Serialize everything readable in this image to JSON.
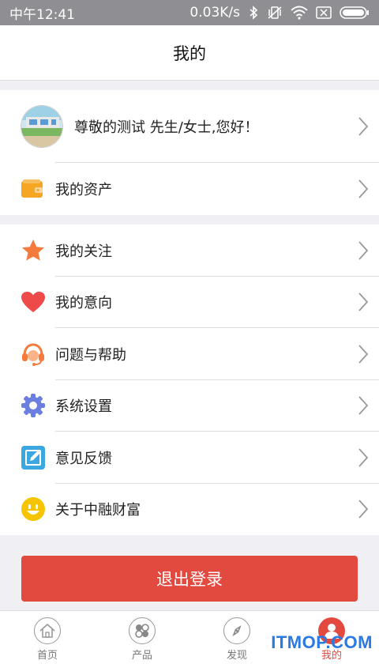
{
  "status_bar": {
    "time": "中午12:41",
    "speed": "0.03K/s"
  },
  "header": {
    "title": "我的"
  },
  "profile": {
    "greeting": "尊敬的测试 先生/女士,您好！"
  },
  "asset": {
    "label": "我的资产"
  },
  "menu": [
    {
      "label": "我的关注",
      "icon": "star-icon",
      "color": "#f47b3c"
    },
    {
      "label": "我的意向",
      "icon": "heart-icon",
      "color": "#ef4a4a"
    },
    {
      "label": "问题与帮助",
      "icon": "headset-icon",
      "color": "#f47b3c"
    },
    {
      "label": "系统设置",
      "icon": "gear-icon",
      "color": "#6a7fe0"
    },
    {
      "label": "意见反馈",
      "icon": "edit-icon",
      "color": "#3aa7e0"
    },
    {
      "label": "关于中融财富",
      "icon": "smiley-icon",
      "color": "#f6c400"
    }
  ],
  "logout": {
    "label": "退出登录"
  },
  "tabbar": {
    "tabs": [
      {
        "label": "首页",
        "icon": "home-icon"
      },
      {
        "label": "产品",
        "icon": "product-icon"
      },
      {
        "label": "发现",
        "icon": "compass-icon"
      },
      {
        "label": "我的",
        "icon": "person-icon"
      }
    ],
    "active_color": "#e24a40"
  },
  "watermark": "ITMOP.COM"
}
